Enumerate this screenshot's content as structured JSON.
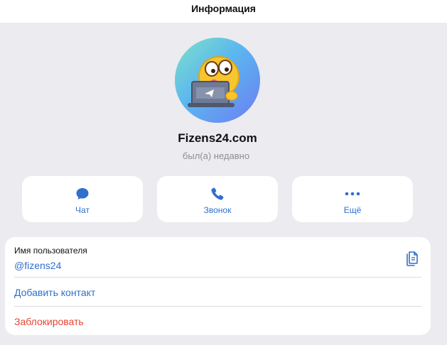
{
  "header": {
    "title": "Информация"
  },
  "profile": {
    "name": "Fizens24.com",
    "status": "был(а) недавно"
  },
  "actions": [
    {
      "label": "Чат",
      "icon": "chat-bubble-icon"
    },
    {
      "label": "Звонок",
      "icon": "phone-icon"
    },
    {
      "label": "Ещё",
      "icon": "more-dots-icon"
    }
  ],
  "info": {
    "username_label": "Имя пользователя",
    "username_value": "@fizens24",
    "add_contact_label": "Добавить контакт",
    "block_label": "Заблокировать"
  },
  "colors": {
    "accent": "#2f6fcf",
    "danger": "#e5432f",
    "background": "#ebebf0",
    "card": "#ffffff"
  }
}
